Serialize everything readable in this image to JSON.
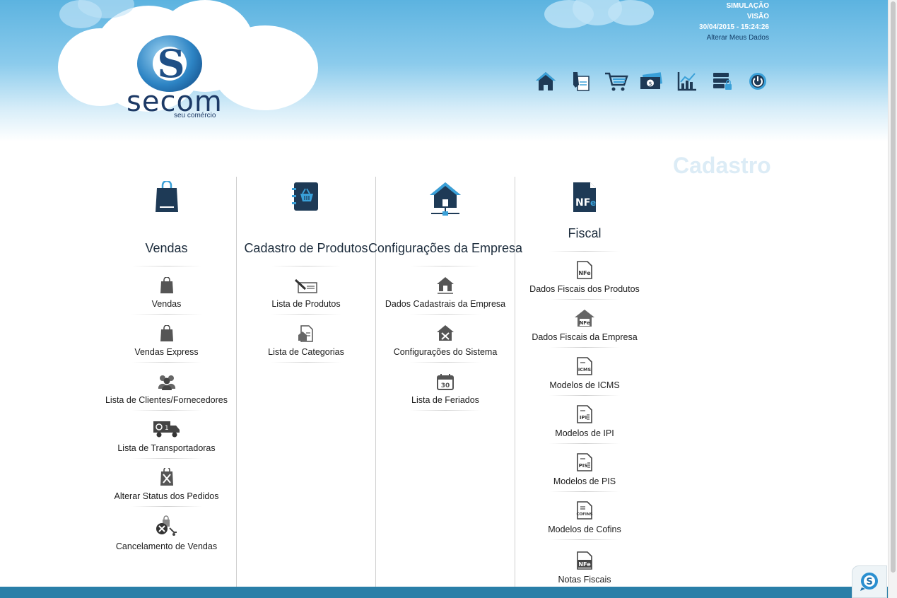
{
  "header": {
    "logo": {
      "letter": "S",
      "word": "secom",
      "tagline": "seu comércio"
    },
    "user": {
      "line1": "SIMULAÇÃO",
      "line2": "VISÃO",
      "datetime": "30/04/2015 - 15:24:26",
      "edit_link": "Alterar Meus Dados"
    },
    "nav_icons": [
      "home-icon",
      "edit-document-icon",
      "cart-icon",
      "money-icon",
      "chart-icon",
      "database-lock-icon",
      "power-icon"
    ]
  },
  "page_title": "Cadastro",
  "columns": [
    {
      "title": "Vendas",
      "icon": "shopping-bag-icon",
      "items": [
        {
          "label": "Vendas",
          "icon": "bag-icon"
        },
        {
          "label": "Vendas Express",
          "icon": "bag-icon"
        },
        {
          "label": "Lista de Clientes/Fornecedores",
          "icon": "people-icon"
        },
        {
          "label": "Lista de Transportadoras",
          "icon": "truck-icon"
        },
        {
          "label": "Alterar Status dos Pedidos",
          "icon": "tools-bag-icon"
        },
        {
          "label": "Cancelamento de Vendas",
          "icon": "cancel-cart-icon"
        }
      ]
    },
    {
      "title": "Cadastro de Produtos",
      "icon": "product-catalog-icon",
      "items": [
        {
          "label": "Lista de Produtos",
          "icon": "pen-document-icon"
        },
        {
          "label": "Lista de Categorias",
          "icon": "category-document-icon"
        }
      ]
    },
    {
      "title": "Configurações da Empresa",
      "icon": "company-network-icon",
      "items": [
        {
          "label": "Dados Cadastrais da Empresa",
          "icon": "house-icon"
        },
        {
          "label": "Configurações do Sistema",
          "icon": "house-tools-icon"
        },
        {
          "label": "Lista de Feriados",
          "icon": "calendar-icon"
        }
      ]
    },
    {
      "title": "Fiscal",
      "icon": "nfe-icon",
      "items": [
        {
          "label": "Dados Fiscais dos Produtos",
          "icon": "nfe-doc-icon",
          "badge": "NFe"
        },
        {
          "label": "Dados Fiscais da Empresa",
          "icon": "nfe-house-icon",
          "badge": "NFe"
        },
        {
          "label": "Modelos de ICMS",
          "icon": "icms-doc-icon",
          "badge": "ICMS"
        },
        {
          "label": "Modelos de IPI",
          "icon": "ipi-doc-icon",
          "badge": "IPI"
        },
        {
          "label": "Modelos de PIS",
          "icon": "pis-doc-icon",
          "badge": "PIS"
        },
        {
          "label": "Modelos de Cofins",
          "icon": "cofins-doc-icon",
          "badge": "COFINS"
        },
        {
          "label": "Notas Fiscais",
          "icon": "nfe-doc-icon",
          "badge": "NFe"
        }
      ]
    }
  ],
  "colors": {
    "primary": "#2a7fa8",
    "dark_icon": "#1e3a56",
    "accent_blue": "#3aa0d8",
    "sky": "#5cb3e0"
  }
}
